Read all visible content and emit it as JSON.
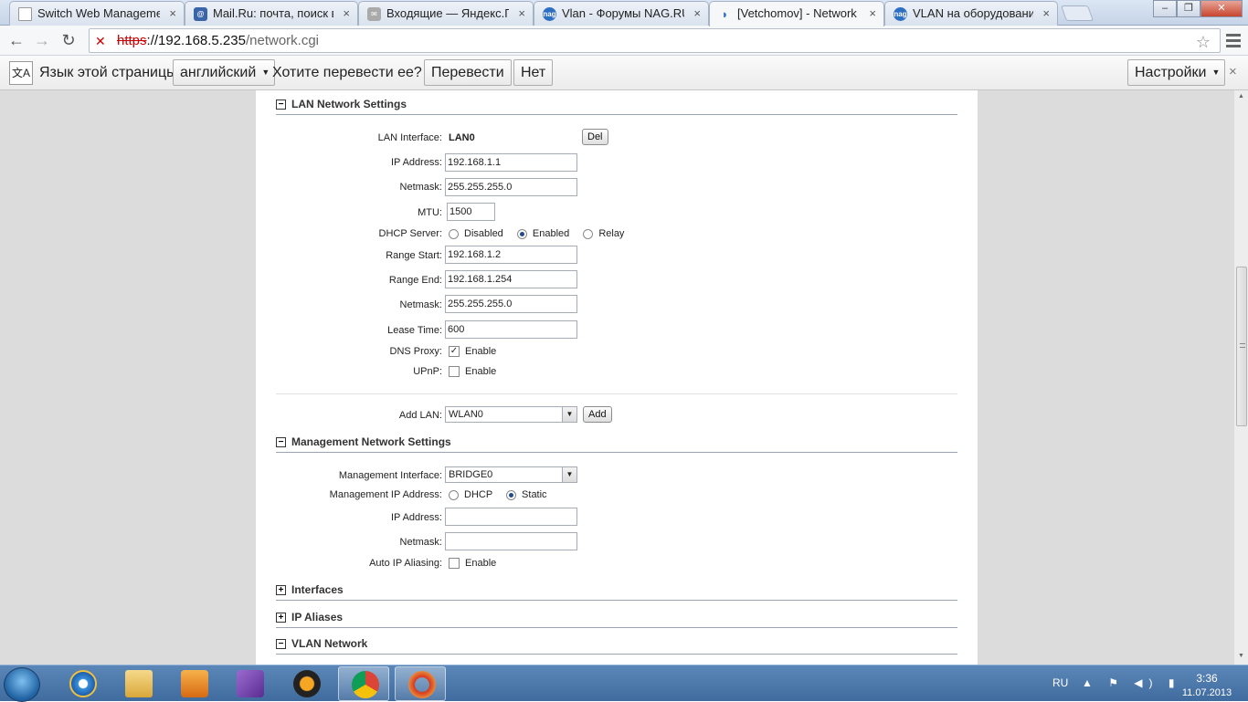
{
  "browser": {
    "tabs": [
      {
        "label": "Switch Web Management",
        "icon": "page-icon",
        "active": false
      },
      {
        "label": "Mail.Ru: почта, поиск в и",
        "icon": "mailru-icon",
        "active": false
      },
      {
        "label": "Входящие — Яндекс.Поч",
        "icon": "mail-icon",
        "active": false
      },
      {
        "label": "Vlan - Форумы NAG.RU",
        "icon": "nag-icon",
        "active": false
      },
      {
        "label": "[Vetchomov] - Network",
        "icon": "wireless-icon",
        "active": true
      },
      {
        "label": "VLAN на оборудовании U",
        "icon": "nag-icon",
        "active": false
      }
    ],
    "tab_close_glyph": "×",
    "window_buttons": {
      "minimize": "–",
      "restore": "❐",
      "close": "✕"
    },
    "url": {
      "scheme": "https",
      "rest_host": "://192.168.5.235",
      "path": "/network.cgi"
    },
    "nav": {
      "back": "←",
      "forward": "→",
      "reload": "↻",
      "star": "☆"
    }
  },
  "translate_bar": {
    "prompt": "Язык этой страницы",
    "language": "английский",
    "question": "Хотите перевести ее?",
    "translate_button": "Перевести",
    "no_button": "Нет",
    "options_button": "Настройки",
    "close": "×"
  },
  "page": {
    "lan": {
      "title": "LAN Network Settings",
      "toggle": "−",
      "interface_label": "LAN Interface:",
      "interface_value": "LAN0",
      "del_button": "Del",
      "ip_label": "IP Address:",
      "ip_value": "192.168.1.1",
      "netmask_label": "Netmask:",
      "netmask_value": "255.255.255.0",
      "mtu_label": "MTU:",
      "mtu_value": "1500",
      "dhcp_label": "DHCP Server:",
      "dhcp_options": [
        "Disabled",
        "Enabled",
        "Relay"
      ],
      "dhcp_selected": "Enabled",
      "range_start_label": "Range Start:",
      "range_start_value": "192.168.1.2",
      "range_end_label": "Range End:",
      "range_end_value": "192.168.1.254",
      "dhcp_netmask_label": "Netmask:",
      "dhcp_netmask_value": "255.255.255.0",
      "lease_label": "Lease Time:",
      "lease_value": "600",
      "dns_proxy_label": "DNS Proxy:",
      "dns_proxy_option": "Enable",
      "dns_proxy_checked": true,
      "upnp_label": "UPnP:",
      "upnp_option": "Enable",
      "upnp_checked": false,
      "add_lan_label": "Add LAN:",
      "add_lan_value": "WLAN0",
      "add_button": "Add"
    },
    "mgmt": {
      "title": "Management Network Settings",
      "toggle": "−",
      "interface_label": "Management Interface:",
      "interface_value": "BRIDGE0",
      "ip_mode_label": "Management IP Address:",
      "ip_mode_options": [
        "DHCP",
        "Static"
      ],
      "ip_mode_selected": "Static",
      "ip_label": "IP Address:",
      "ip_value": "",
      "netmask_label": "Netmask:",
      "netmask_value": "",
      "alias_label": "Auto IP Aliasing:",
      "alias_option": "Enable",
      "alias_checked": false
    },
    "collapsed_sections": [
      {
        "title": "Interfaces",
        "toggle": "+"
      },
      {
        "title": "IP Aliases",
        "toggle": "+"
      },
      {
        "title": "VLAN Network",
        "toggle": "−"
      }
    ]
  },
  "taskbar": {
    "apps": [
      "internet-explorer-icon",
      "file-explorer-icon",
      "media-player-icon",
      "visual-studio-icon",
      "aimp-icon",
      "chrome-icon",
      "opera-icon"
    ],
    "language": "RU",
    "tray_icons": "▲ ⚑ ◀) ▮",
    "time": "3:36",
    "date": "11.07.2013"
  }
}
